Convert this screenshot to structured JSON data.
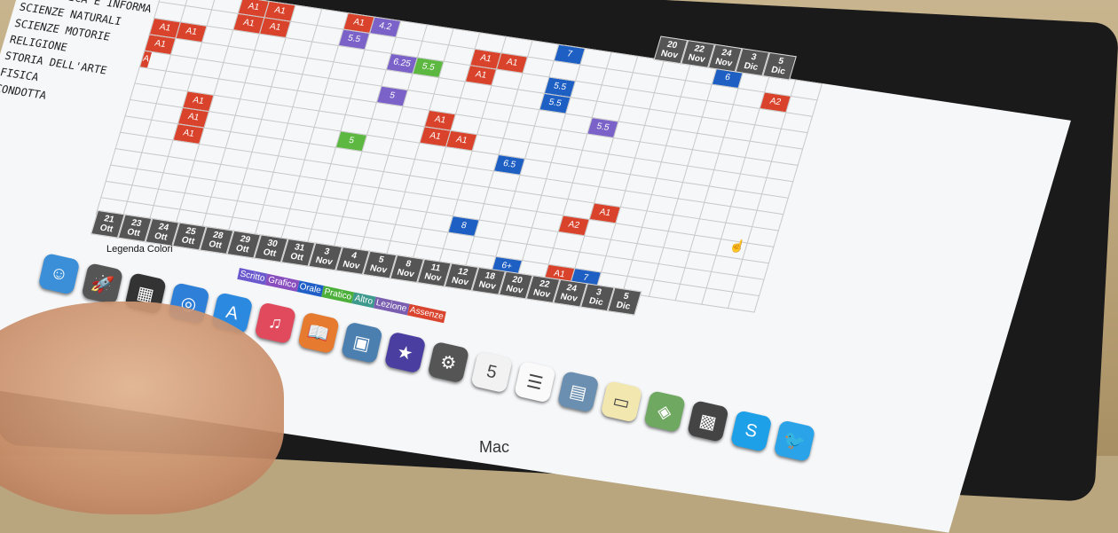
{
  "subjects": [
    {
      "name": "",
      "row": [
        null,
        null,
        null,
        "A1",
        "A1",
        null,
        null,
        "A1",
        "4.2",
        null,
        null,
        null,
        null,
        null,
        null,
        "7",
        null,
        null,
        null,
        null,
        null,
        "6",
        null,
        null,
        null
      ]
    },
    {
      "name": "MATEMATICA E INFORMA",
      "row": [
        null,
        null,
        null,
        "A1",
        "A1",
        null,
        null,
        "5.5",
        null,
        null,
        null,
        null,
        "A1",
        "A1",
        null,
        null,
        null,
        null,
        null,
        null,
        null,
        null,
        null,
        "A2",
        null
      ]
    },
    {
      "name": "SCIENZE NATURALI",
      "row": [
        "A1",
        "A1",
        null,
        null,
        null,
        null,
        null,
        null,
        null,
        "6.25",
        "5.5",
        null,
        "A1",
        null,
        null,
        "5.5",
        null,
        null,
        null,
        null,
        null,
        null,
        null,
        null,
        null
      ]
    },
    {
      "name": "SCIENZE MOTORIE",
      "row": [
        "A1",
        null,
        null,
        null,
        null,
        null,
        null,
        null,
        null,
        null,
        null,
        null,
        null,
        null,
        null,
        "5.5",
        null,
        null,
        null,
        null,
        null,
        null,
        null,
        null,
        null
      ]
    },
    {
      "name": "RELIGIONE",
      "row": [
        "A",
        null,
        null,
        null,
        null,
        null,
        null,
        null,
        null,
        "5",
        null,
        null,
        null,
        null,
        null,
        null,
        null,
        "5.5",
        null,
        null,
        null,
        null,
        null,
        null,
        null
      ]
    },
    {
      "name": "STORIA DELL'ARTE",
      "row": [
        null,
        null,
        null,
        null,
        null,
        null,
        null,
        null,
        null,
        null,
        null,
        "A1",
        null,
        null,
        null,
        null,
        null,
        null,
        null,
        null,
        null,
        null,
        null,
        null,
        null
      ]
    },
    {
      "name": "FISICA",
      "row": [
        null,
        null,
        "A1",
        null,
        null,
        null,
        null,
        null,
        null,
        null,
        null,
        "A1",
        "A1",
        null,
        null,
        null,
        null,
        null,
        null,
        null,
        null,
        null,
        null,
        null,
        null
      ]
    },
    {
      "name": "CONDOTTA",
      "row": [
        null,
        null,
        "A1",
        null,
        null,
        null,
        null,
        null,
        "5",
        null,
        null,
        null,
        null,
        null,
        "6.5",
        null,
        null,
        null,
        null,
        null,
        null,
        null,
        null,
        null,
        null
      ]
    },
    {
      "name": "",
      "row": [
        null,
        null,
        "A1",
        null,
        null,
        null,
        null,
        null,
        null,
        null,
        null,
        null,
        null,
        null,
        null,
        null,
        null,
        null,
        null,
        null,
        null,
        null,
        null,
        null,
        null
      ]
    }
  ],
  "extra_marks": [
    {
      "label": "A1",
      "col": 18,
      "row": 9
    },
    {
      "label": "A2",
      "col": 17,
      "row": 10
    },
    {
      "label": "8",
      "col": 13,
      "row": 11
    },
    {
      "label": "6+",
      "col": 15,
      "row": 13
    },
    {
      "label": "A1",
      "col": 17,
      "row": 13
    },
    {
      "label": "7",
      "col": 18,
      "row": 13
    }
  ],
  "dates_top": [
    {
      "d": "",
      "m": ""
    },
    {
      "d": "",
      "m": ""
    },
    {
      "d": "",
      "m": ""
    },
    {
      "d": "",
      "m": ""
    },
    {
      "d": "",
      "m": ""
    },
    {
      "d": "",
      "m": ""
    },
    {
      "d": "",
      "m": ""
    },
    {
      "d": "",
      "m": ""
    },
    {
      "d": "",
      "m": ""
    },
    {
      "d": "",
      "m": ""
    },
    {
      "d": "",
      "m": ""
    },
    {
      "d": "",
      "m": ""
    },
    {
      "d": "",
      "m": ""
    },
    {
      "d": "",
      "m": ""
    },
    {
      "d": "",
      "m": ""
    },
    {
      "d": "",
      "m": ""
    },
    {
      "d": "",
      "m": ""
    },
    {
      "d": "",
      "m": ""
    },
    {
      "d": "20",
      "m": "Nov"
    },
    {
      "d": "22",
      "m": "Nov"
    },
    {
      "d": "24",
      "m": "Nov"
    },
    {
      "d": "3",
      "m": "Dic"
    },
    {
      "d": "5",
      "m": "Dic"
    }
  ],
  "dates_bottom": [
    {
      "d": "21",
      "m": "Ott"
    },
    {
      "d": "23",
      "m": "Ott"
    },
    {
      "d": "24",
      "m": "Ott"
    },
    {
      "d": "25",
      "m": "Ott"
    },
    {
      "d": "28",
      "m": "Ott"
    },
    {
      "d": "29",
      "m": "Ott"
    },
    {
      "d": "30",
      "m": "Ott"
    },
    {
      "d": "31",
      "m": "Ott"
    },
    {
      "d": "3",
      "m": "Nov"
    },
    {
      "d": "4",
      "m": "Nov"
    },
    {
      "d": "5",
      "m": "Nov"
    },
    {
      "d": "8",
      "m": "Nov"
    },
    {
      "d": "11",
      "m": "Nov"
    },
    {
      "d": "12",
      "m": "Nov"
    },
    {
      "d": "18",
      "m": "Nov"
    },
    {
      "d": "20",
      "m": "Nov"
    },
    {
      "d": "22",
      "m": "Nov"
    },
    {
      "d": "24",
      "m": "Nov"
    },
    {
      "d": "3",
      "m": "Dic"
    },
    {
      "d": "5",
      "m": "Dic"
    }
  ],
  "legend": {
    "title": "Legenda Colori",
    "items": [
      {
        "label": "Scritto",
        "color": "#6a5acd"
      },
      {
        "label": "Grafico",
        "color": "#8a4fbf"
      },
      {
        "label": "Orale",
        "color": "#1f5fc7"
      },
      {
        "label": "Pratico",
        "color": "#4caf3a"
      },
      {
        "label": "Altro",
        "color": "#3d9a8c"
      },
      {
        "label": "Lezione",
        "color": "#7a5fb0"
      },
      {
        "label": "Assenze",
        "color": "#d9452e"
      }
    ]
  },
  "mark_colors": {
    "A": "#d9432b",
    "purple": "#7a62c8",
    "green": "#5cb840",
    "blue": "#1e5fc4"
  },
  "dock": [
    {
      "name": "finder-icon",
      "glyph": "☺",
      "color": "#3a8fd8"
    },
    {
      "name": "launchpad-icon",
      "glyph": "🚀",
      "color": "#555"
    },
    {
      "name": "mission-control-icon",
      "glyph": "▦",
      "color": "#333"
    },
    {
      "name": "safari-icon",
      "glyph": "◎",
      "color": "#2d7fd8"
    },
    {
      "name": "app-store-icon",
      "glyph": "A",
      "color": "#2b8ae0"
    },
    {
      "name": "itunes-icon",
      "glyph": "♫",
      "color": "#e04a5c"
    },
    {
      "name": "ibooks-icon",
      "glyph": "📖",
      "color": "#e67a2e"
    },
    {
      "name": "preview-icon",
      "glyph": "▣",
      "color": "#4b7fb0"
    },
    {
      "name": "imovie-icon",
      "glyph": "★",
      "color": "#4a3fa0"
    },
    {
      "name": "system-preferences-icon",
      "glyph": "⚙",
      "color": "#555"
    },
    {
      "name": "calendar-icon",
      "glyph": "5",
      "color": "#f2f2f2"
    },
    {
      "name": "reminders-icon",
      "glyph": "☰",
      "color": "#fafafa"
    },
    {
      "name": "photo-browser-icon",
      "glyph": "▤",
      "color": "#6a8fb0"
    },
    {
      "name": "notes-icon",
      "glyph": "▭",
      "color": "#f3e7b0"
    },
    {
      "name": "maps-icon",
      "glyph": "◈",
      "color": "#6fa860"
    },
    {
      "name": "image-capture-icon",
      "glyph": "▩",
      "color": "#444"
    },
    {
      "name": "skype-icon",
      "glyph": "S",
      "color": "#1ea0e8"
    },
    {
      "name": "twitter-icon",
      "glyph": "🐦",
      "color": "#2aa3e8"
    }
  ],
  "bottom_text": "Mac"
}
